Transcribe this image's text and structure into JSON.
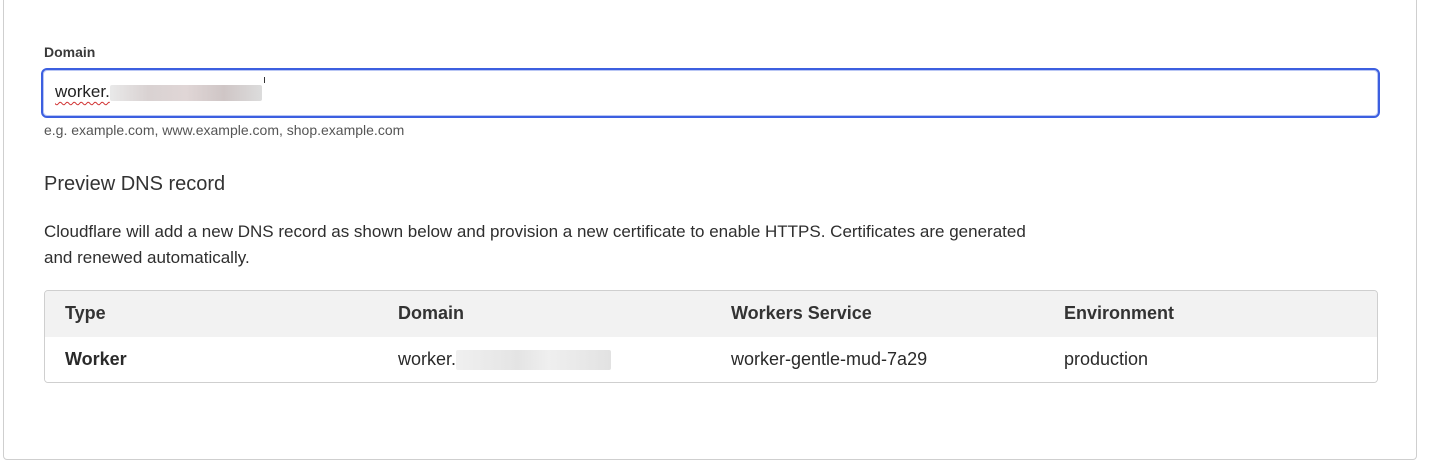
{
  "form": {
    "label": "Domain",
    "input_value": "worker.",
    "hint": "e.g. example.com, www.example.com, shop.example.com"
  },
  "preview": {
    "title": "Preview DNS record",
    "description": "Cloudflare will add a new DNS record as shown below and provision a new certificate to enable HTTPS. Certificates are generated and renewed automatically."
  },
  "table": {
    "headers": [
      "Type",
      "Domain",
      "Workers Service",
      "Environment"
    ],
    "rows": [
      {
        "type": "Worker",
        "domain": "worker.",
        "service": "worker-gentle-mud-7a29",
        "environment": "production"
      }
    ]
  }
}
